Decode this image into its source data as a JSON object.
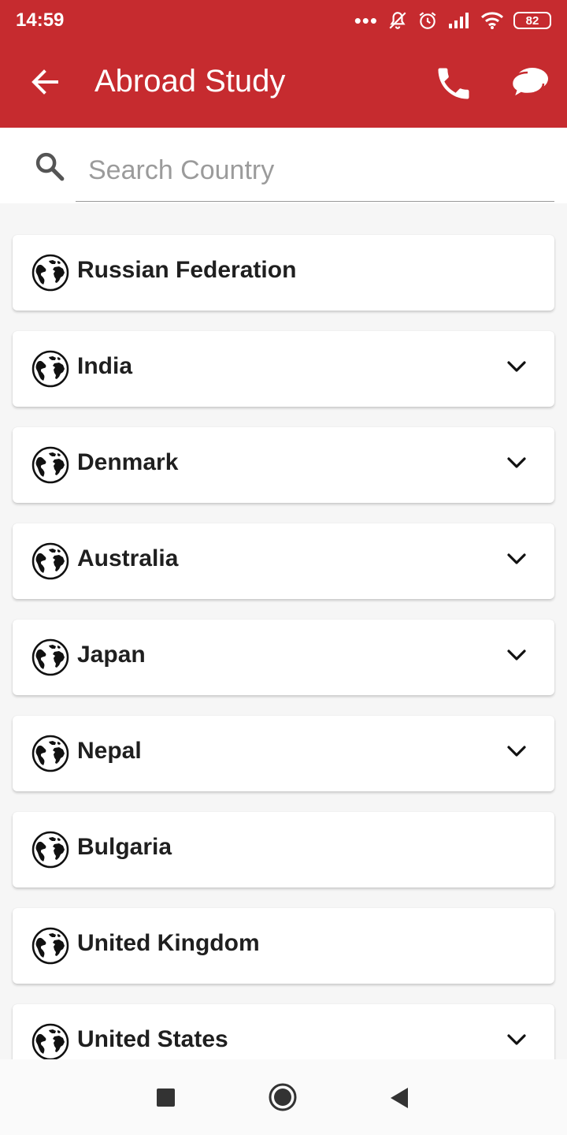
{
  "status_bar": {
    "time": "14:59",
    "dots": "•••",
    "battery": "82"
  },
  "app_bar": {
    "title": "Abroad Study"
  },
  "search": {
    "placeholder": "Search Country",
    "value": ""
  },
  "countries": [
    {
      "name": "Russian Federation",
      "expandable": false
    },
    {
      "name": "India",
      "expandable": true
    },
    {
      "name": "Denmark",
      "expandable": true
    },
    {
      "name": "Australia",
      "expandable": true
    },
    {
      "name": "Japan",
      "expandable": true
    },
    {
      "name": "Nepal",
      "expandable": true
    },
    {
      "name": "Bulgaria",
      "expandable": false
    },
    {
      "name": "United Kingdom",
      "expandable": false
    },
    {
      "name": "United States",
      "expandable": true
    }
  ],
  "colors": {
    "primary": "#c62b2f",
    "background": "#f6f6f6"
  }
}
